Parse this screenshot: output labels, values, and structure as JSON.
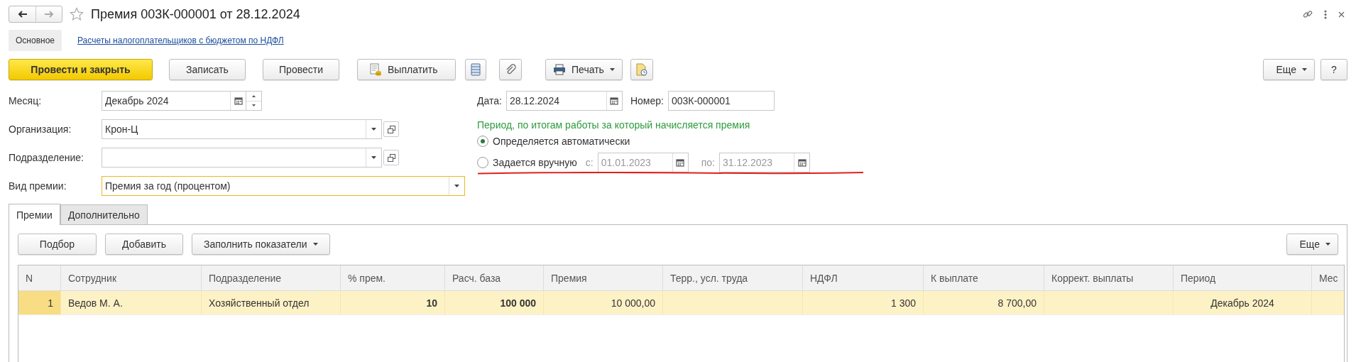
{
  "window": {
    "title": "Премия 003К-000001 от 28.12.2024"
  },
  "sections": [
    {
      "label": "Основное",
      "selected": true
    },
    {
      "label": "Расчеты налогоплательщиков с бюджетом по НДФЛ",
      "selected": false
    }
  ],
  "toolbar": {
    "post_close": "Провести и закрыть",
    "save": "Записать",
    "post": "Провести",
    "pay": "Выплатить",
    "print": "Печать",
    "more": "Еще",
    "help": "?"
  },
  "fields": [
    {
      "label": "Месяц:",
      "value": "Декабрь 2024",
      "kind": "month",
      "focused": false
    },
    {
      "label": "Организация:",
      "value": "Крон-Ц",
      "kind": "select",
      "focused": false
    },
    {
      "label": "Подразделение:",
      "kind": "select",
      "focused": false
    },
    {
      "label": "Вид премии:",
      "value": "Премия за год (процентом)",
      "kind": "select",
      "focused": true
    }
  ],
  "date": {
    "label": "Дата:",
    "value": "28.12.2024"
  },
  "number": {
    "label": "Номер:",
    "value": "003К-000001"
  },
  "period": {
    "heading": "Период, по итогам работы за который начисляется премия",
    "options": [
      {
        "label": "Определяется автоматически",
        "selected": true
      },
      {
        "label": "Задается вручную",
        "selected": false
      }
    ],
    "from_label": "с:",
    "from_value": "01.01.2023",
    "to_label": "по:",
    "to_value": "31.12.2023",
    "disabled": true
  },
  "tabs": [
    {
      "label": "Премии",
      "selected": true
    },
    {
      "label": "Дополнительно",
      "selected": false
    }
  ],
  "table_toolbar": {
    "pick": "Подбор",
    "add": "Добавить",
    "fill": "Заполнить показатели",
    "more": "Еще"
  },
  "table": {
    "columns": [
      {
        "label": "N",
        "kind": "index"
      },
      {
        "label": "Сотрудник",
        "kind": "text"
      },
      {
        "label": "Подразделение",
        "kind": "text"
      },
      {
        "label": "% прем.",
        "kind": "key_amount"
      },
      {
        "label": "Расч. база",
        "kind": "key_amount"
      },
      {
        "label": "Премия",
        "kind": "amount"
      },
      {
        "label": "Терр., усл. труда",
        "kind": "text"
      },
      {
        "label": "НДФЛ",
        "kind": "amount"
      },
      {
        "label": "К выплате",
        "kind": "amount"
      },
      {
        "label": "Коррект. выплаты",
        "kind": "amount"
      },
      {
        "label": "Период",
        "kind": "period"
      },
      {
        "label": "Мес",
        "kind": "text"
      }
    ],
    "rows": [
      {
        "selected": true,
        "cells": [
          "1",
          "Ведов М. А.",
          "Хозяйственный отдел",
          "10",
          "100 000",
          "10 000,00",
          null,
          "1 300",
          "8 700,00",
          null,
          "Декабрь 2024",
          null
        ]
      }
    ]
  }
}
